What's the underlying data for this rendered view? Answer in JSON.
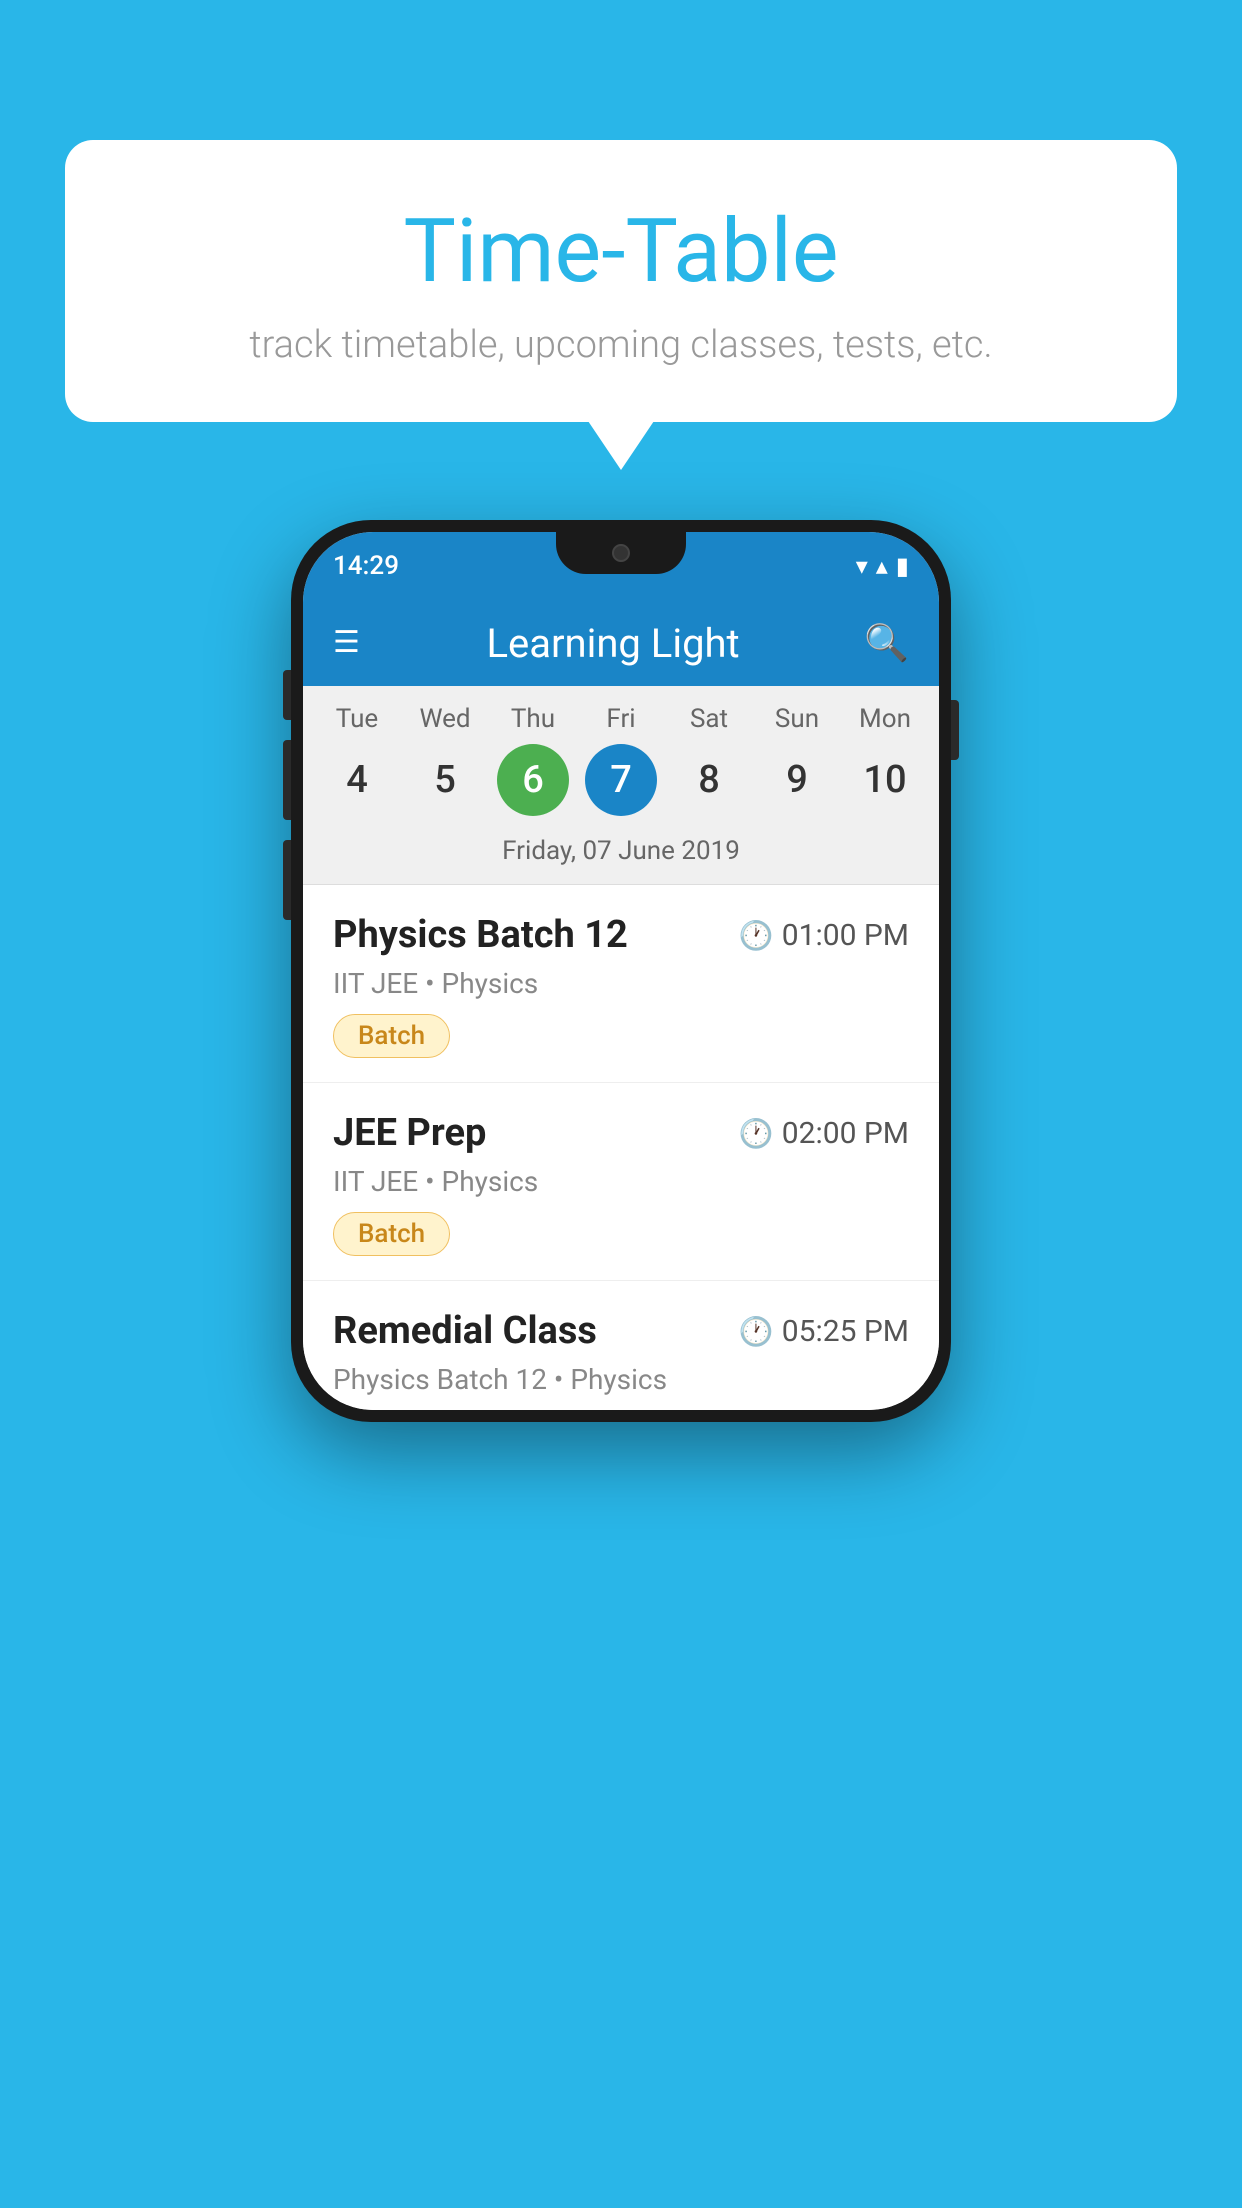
{
  "background": {
    "color": "#29B6E8"
  },
  "speech_bubble": {
    "title": "Time-Table",
    "subtitle": "track timetable, upcoming classes, tests, etc."
  },
  "status_bar": {
    "time": "14:29",
    "wifi": "▾",
    "signal": "▴",
    "battery": "▮"
  },
  "app_header": {
    "title": "Learning Light",
    "menu_icon": "menu-icon",
    "search_icon": "search-icon"
  },
  "calendar": {
    "days": [
      {
        "label": "Tue",
        "num": "4"
      },
      {
        "label": "Wed",
        "num": "5"
      },
      {
        "label": "Thu",
        "num": "6",
        "state": "today"
      },
      {
        "label": "Fri",
        "num": "7",
        "state": "selected"
      },
      {
        "label": "Sat",
        "num": "8"
      },
      {
        "label": "Sun",
        "num": "9"
      },
      {
        "label": "Mon",
        "num": "10"
      }
    ],
    "selected_date": "Friday, 07 June 2019"
  },
  "schedule": {
    "items": [
      {
        "title": "Physics Batch 12",
        "time": "01:00 PM",
        "subtitle": "IIT JEE • Physics",
        "tag": "Batch"
      },
      {
        "title": "JEE Prep",
        "time": "02:00 PM",
        "subtitle": "IIT JEE • Physics",
        "tag": "Batch"
      },
      {
        "title": "Remedial Class",
        "time": "05:25 PM",
        "subtitle": "Physics Batch 12 • Physics",
        "tag": null
      }
    ]
  }
}
